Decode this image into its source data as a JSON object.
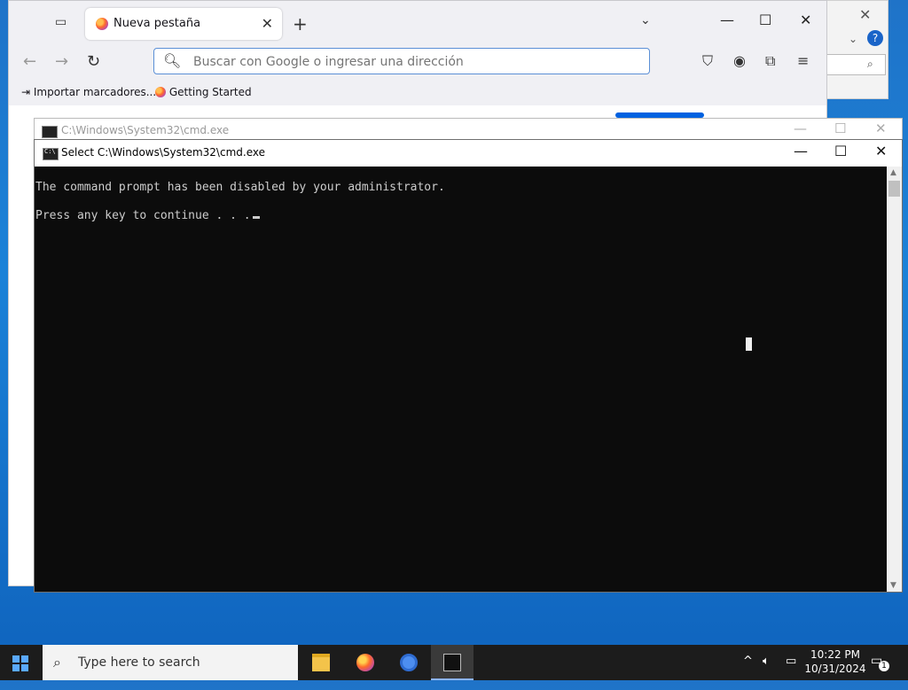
{
  "firefox": {
    "tab_title": "Nueva pestaña",
    "url_placeholder": "Buscar con Google o ingresar una dirección",
    "bookmarks": [
      "Importar marcadores...",
      "Getting Started"
    ]
  },
  "cmd_back": {
    "title": "C:\\Windows\\System32\\cmd.exe"
  },
  "cmd": {
    "title": "Select C:\\Windows\\System32\\cmd.exe",
    "lines": [
      "The command prompt has been disabled by your administrator.",
      "Press any key to continue . . ."
    ]
  },
  "taskbar": {
    "search_text": "Type here to search",
    "time": "10:22 PM",
    "date": "10/31/2024",
    "notification_count": "1"
  },
  "icons": {
    "start": "windows-logo-icon",
    "explorer": "folder-icon",
    "firefox": "firefox-icon",
    "chrome": "chrome-icon",
    "terminal": "terminal-icon"
  }
}
